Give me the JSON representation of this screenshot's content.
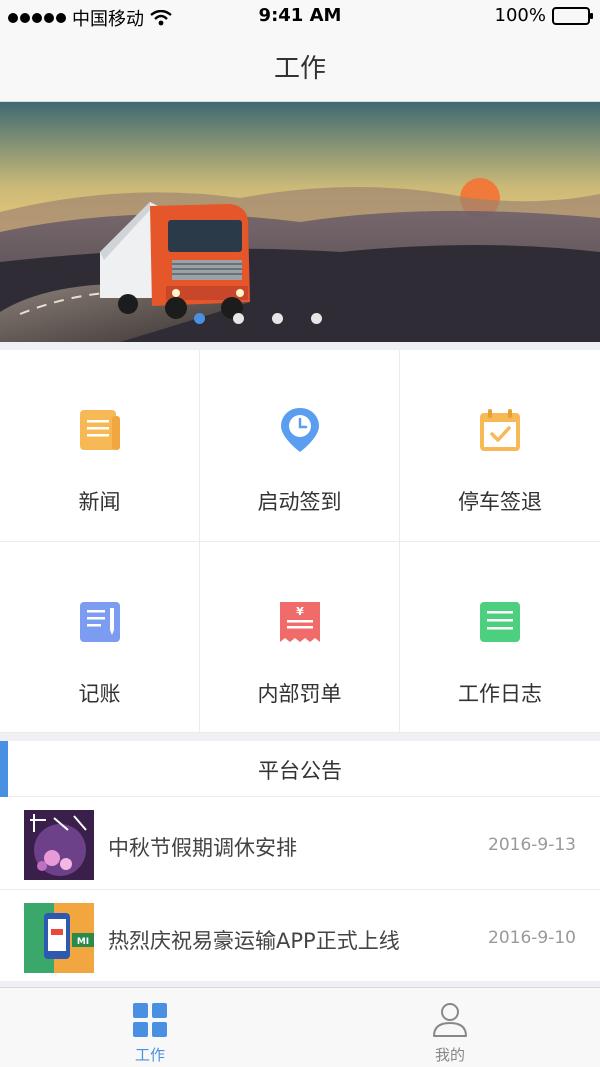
{
  "status_bar": {
    "carrier": "中国移动",
    "time": "9:41 AM",
    "battery": "100%"
  },
  "header": {
    "title": "工作"
  },
  "banner": {
    "slide_count": 4,
    "active_slide": 1
  },
  "grid": {
    "items": [
      {
        "label": "新闻",
        "icon": "news-icon",
        "color": "#f7b955"
      },
      {
        "label": "启动签到",
        "icon": "location-pin-icon",
        "color": "#5b9ef0"
      },
      {
        "label": "停车签退",
        "icon": "calendar-check-icon",
        "color": "#f7b955"
      },
      {
        "label": "记账",
        "icon": "notepad-icon",
        "color": "#7b9cf0"
      },
      {
        "label": "内部罚单",
        "icon": "receipt-icon",
        "color": "#f26b6b"
      },
      {
        "label": "工作日志",
        "icon": "document-list-icon",
        "color": "#4ccf7e"
      }
    ]
  },
  "notice": {
    "title": "平台公告",
    "items": [
      {
        "text": "中秋节假期调休安排",
        "date": "2016-9-13"
      },
      {
        "text": "热烈庆祝易豪运输APP正式上线",
        "date": "2016-9-10"
      }
    ]
  },
  "tabbar": {
    "items": [
      {
        "label": "工作",
        "icon": "grid-icon",
        "active": true
      },
      {
        "label": "我的",
        "icon": "person-icon",
        "active": false
      }
    ]
  },
  "colors": {
    "accent": "#4a90e2",
    "background": "#eef0f3"
  }
}
